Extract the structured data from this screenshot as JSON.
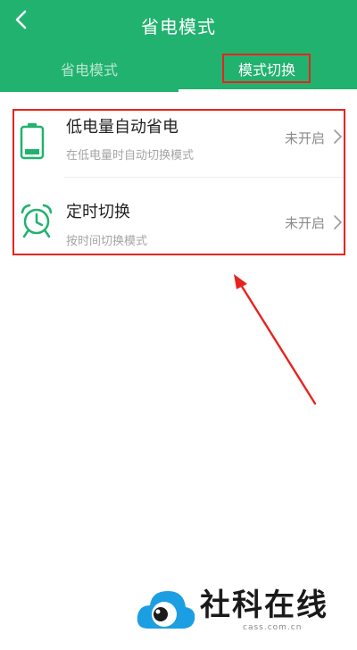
{
  "header": {
    "title": "省电模式",
    "back_icon": "chevron-left-icon",
    "background": "#21b26f"
  },
  "tabs": [
    {
      "label": "省电模式",
      "active": false
    },
    {
      "label": "模式切换",
      "active": true
    }
  ],
  "rows": [
    {
      "title": "低电量自动省电",
      "subtitle": "在低电量时自动切换模式",
      "status": "未开启",
      "icon": "battery-icon"
    },
    {
      "title": "定时切换",
      "subtitle": "按时间切换模式",
      "status": "未开启",
      "icon": "alarm-clock-icon"
    }
  ],
  "annotations": {
    "highlight_color": "#e8231f"
  },
  "watermark": {
    "brand": "社科在线",
    "url": "cass.com.cn"
  }
}
